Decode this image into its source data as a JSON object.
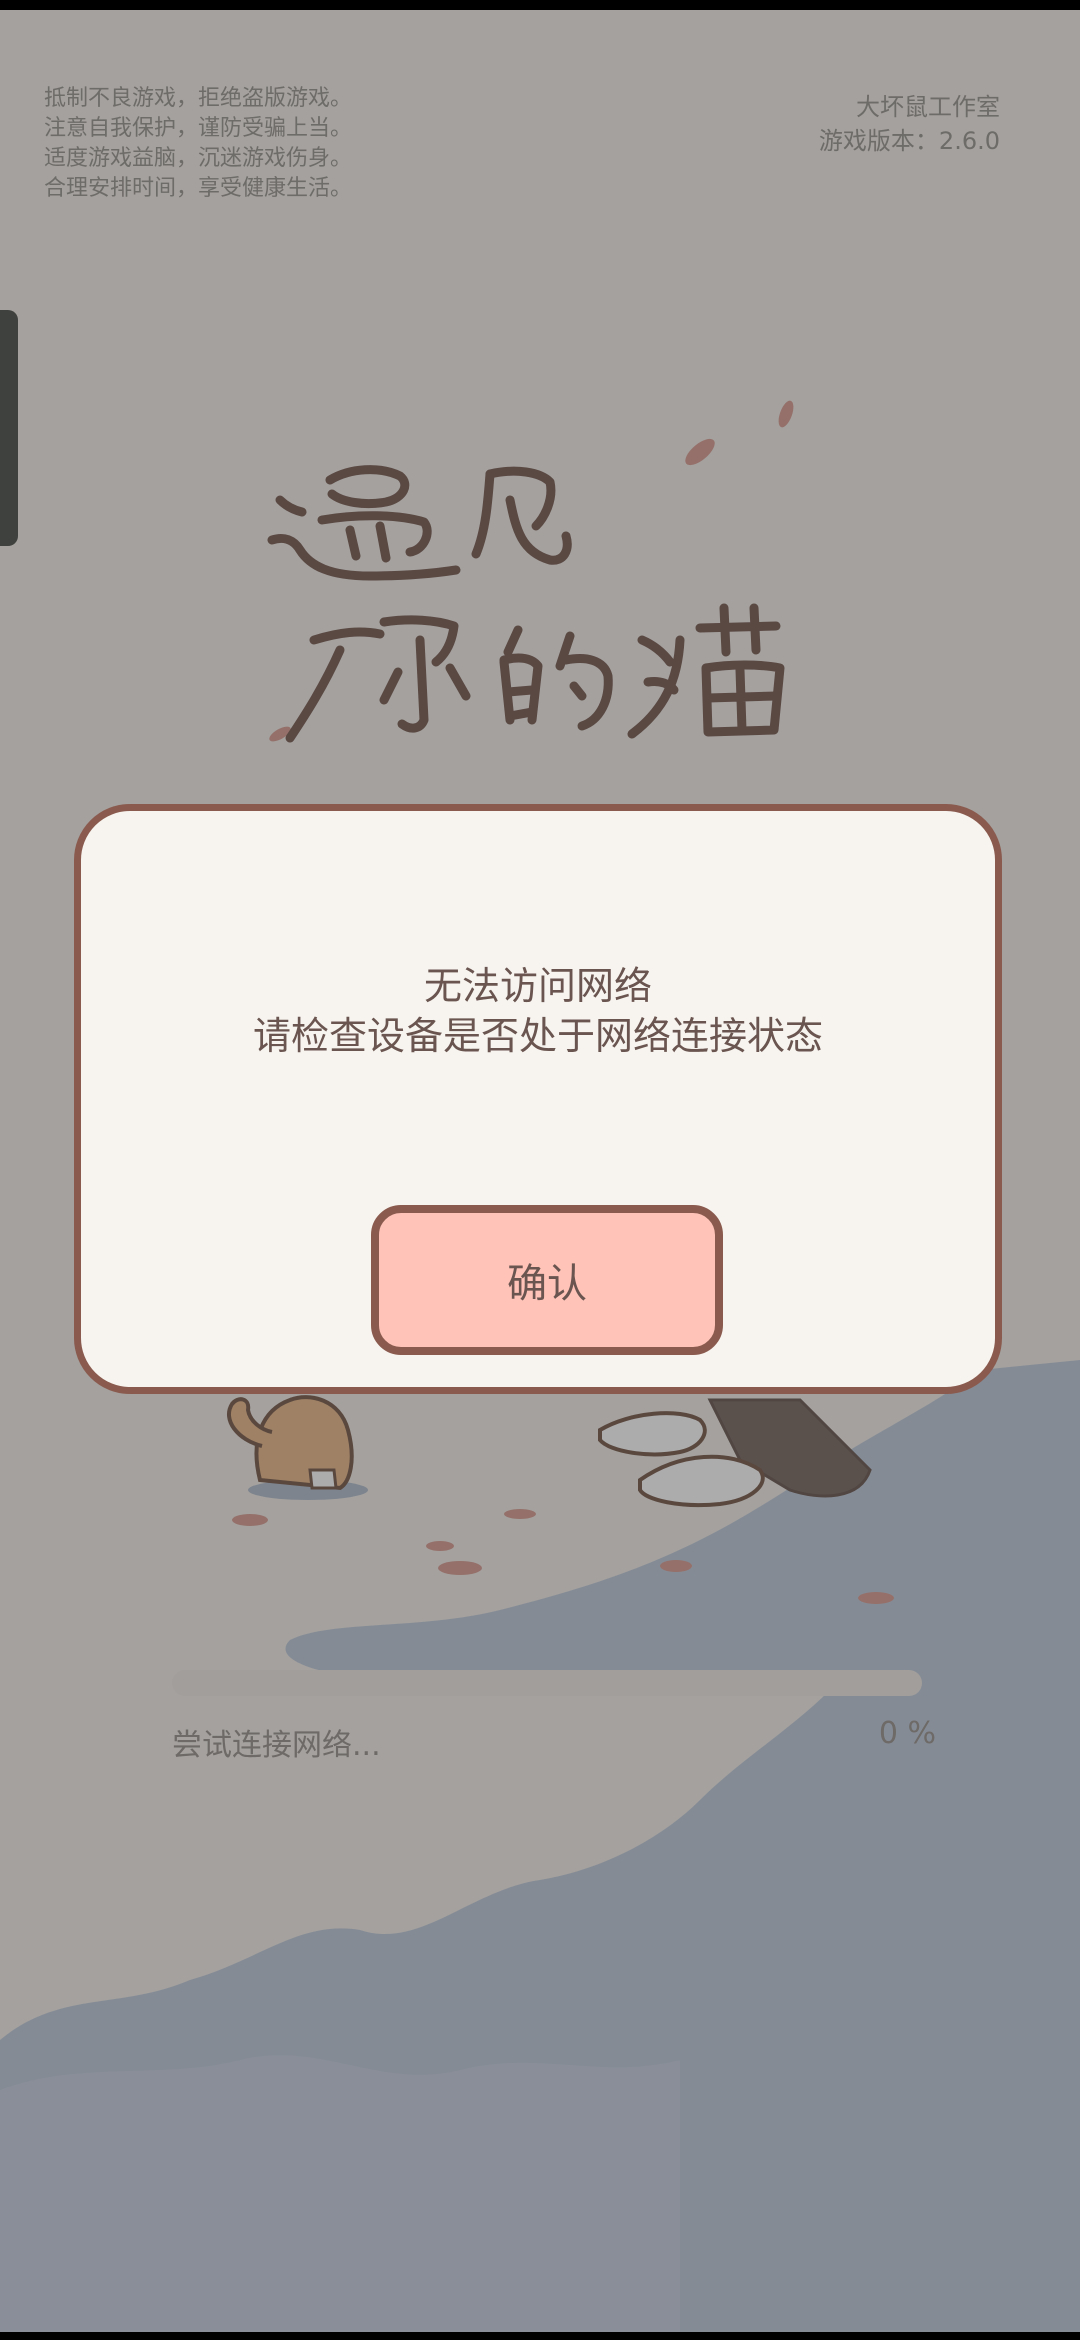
{
  "notice": {
    "lines": [
      "抵制不良游戏，拒绝盗版游戏。",
      "注意自我保护，谨防受骗上当。",
      "适度游戏益脑，沉迷游戏伤身。",
      "合理安排时间，享受健康生活。"
    ]
  },
  "studio": {
    "name": "大坏鼠工作室",
    "version": "游戏版本：2.6.0"
  },
  "logo": {
    "text": "遇见你的猫"
  },
  "loading": {
    "label": "尝试连接网络...",
    "percent_text": "0 %",
    "progress_fraction": 0
  },
  "dialog": {
    "line1": "无法访问网络",
    "line2": "请检查设备是否处于网络连接状态",
    "confirm_label": "确认"
  }
}
